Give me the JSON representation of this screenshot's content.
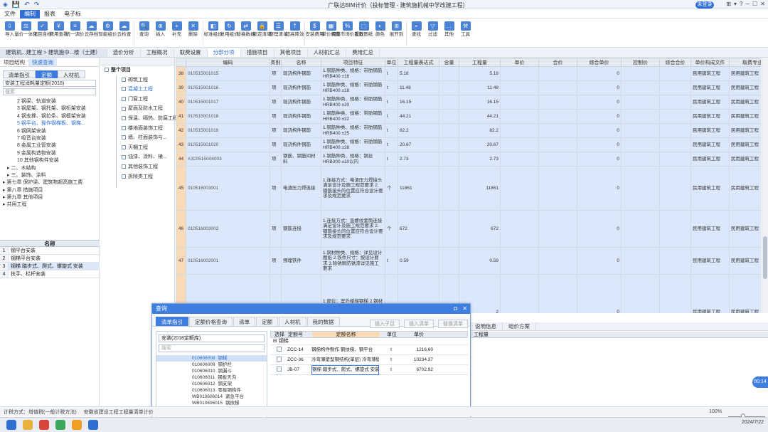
{
  "window": {
    "title": "广联达BIM计价（投标管理 - 建筑施机械中学改建工程）",
    "login_badge": "未登录",
    "controls": [
      "⊞",
      "▾",
      "◻",
      "?",
      "─",
      "☐",
      "✕"
    ]
  },
  "menu": [
    "文件",
    "编制",
    "报表",
    "电子标"
  ],
  "toolbar": [
    "导入",
    "量价一体化",
    "项目自检",
    "费用查看",
    "统一调价",
    "云存档",
    "智能组价",
    "云检查",
    "查询",
    "插入",
    "补充",
    "删除",
    "标准组价",
    "复用组价",
    "替换数据",
    "锁定清单",
    "整理清单",
    "超高降效",
    "安装费用",
    "单价构成",
    "调整市场价系数",
    "提取图纸",
    "颜色",
    "展开到",
    "查找",
    "过滤",
    "其他",
    "工具"
  ],
  "doc_tabs": [
    "建筑机...建工程 > 建筑施中...楼（土建）",
    "造价分析",
    "工程概况",
    "取费设置",
    "分部分项",
    "措施项目",
    "其他项目",
    "人材机汇总",
    "费用汇总"
  ],
  "left_tabs": [
    "项目结构",
    "快速查询"
  ],
  "left_seg": [
    "清单指引",
    "定额",
    "人材机"
  ],
  "left_select": "安装工程消耗量定额(2018)",
  "left_search": "搜索",
  "left_tree": [
    "2  钢梁、轨道安装",
    "3  钢屋架、钢托架、钢桁架安装",
    "4  钢支撑、钢拉条、钢檩架安装",
    "5  钢平台、操作钢梯板、钢梯...",
    "6  钢网架安装",
    "7  吸音台安装",
    "8  金属工业管安装",
    "9  金属构造物安装",
    "10  其他钢构件安装",
    "▸ 二、木结构",
    "▸ 三、装饰、涂料",
    "▸ 第七章 保护梁、建筑物超高施工费",
    "▸ 第八章 措施项目",
    "▸ 第九章 其他项目",
    "▸ 共用工程"
  ],
  "left_mini_table": {
    "header": "名称",
    "rows": [
      "钢平台安装",
      "钢梯平台安装",
      "钢梯 踏步式、爬式、螺旋式 安装",
      "扶手、栏杆安装"
    ]
  },
  "project_tree": {
    "root": "整个项目",
    "items": [
      "砌筑工程",
      "混凝土工程",
      "门窗工程",
      "屋面及防水工程",
      "保温、隔热、防腐工程",
      "楼地面装饰工程",
      "墙、柱面装饰与...",
      "天棚工程",
      "油漆、涂料、裱...",
      "其他装饰工程",
      "拆除类工程"
    ]
  },
  "grid": {
    "headers": [
      "",
      "编码",
      "类别",
      "名称",
      "项目特征",
      "单位",
      "工程量表达式",
      "含量",
      "工程量",
      "单价",
      "合价",
      "综合单价",
      "控制价",
      "综合合价",
      "单价构成文件",
      "取费专业"
    ],
    "rows": [
      {
        "idx": "38",
        "code": "010515001015",
        "type": "项",
        "name": "现浇构件钢筋",
        "spec": "1.钢筋种类、规格：带肋钢筋 HRB400 ±16",
        "unit": "t",
        "expr": "5.18",
        "qty": "5.18",
        "price": "0",
        "file": "民用建筑工程",
        "prof": "民用建筑工程"
      },
      {
        "idx": "39",
        "code": "010515001016",
        "type": "项",
        "name": "现浇构件钢筋",
        "spec": "1.钢筋种类、规格：带肋钢筋 HRB400 ±18",
        "unit": "t",
        "expr": "11.48",
        "qty": "11.48",
        "price": "0",
        "file": "民用建筑工程",
        "prof": "民用建筑工程"
      },
      {
        "idx": "40",
        "code": "010515001017",
        "type": "项",
        "name": "现浇构件钢筋",
        "spec": "1.钢筋种类、规格：带肋钢筋 HRB400 ±20",
        "unit": "t",
        "expr": "16.15",
        "qty": "16.15",
        "price": "0",
        "file": "民用建筑工程",
        "prof": "民用建筑工程"
      },
      {
        "idx": "41",
        "code": "010515001018",
        "type": "项",
        "name": "现浇构件钢筋",
        "spec": "1.钢筋种类、规格：带肋钢筋 HRB400 ±22",
        "unit": "t",
        "expr": "44.21",
        "qty": "44.21",
        "price": "0",
        "file": "民用建筑工程",
        "prof": "民用建筑工程"
      },
      {
        "idx": "42",
        "code": "010515001019",
        "type": "项",
        "name": "现浇构件钢筋",
        "spec": "1.钢筋种类、规格：带肋钢筋 HRB400 ±25",
        "unit": "t",
        "expr": "82.2",
        "qty": "82.2",
        "price": "0",
        "file": "民用建筑工程",
        "prof": "民用建筑工程"
      },
      {
        "idx": "43",
        "code": "010515001020",
        "type": "项",
        "name": "现浇构件钢筋",
        "spec": "1.钢筋种类、规格：带肋钢筋 HRB400 ±28",
        "unit": "t",
        "expr": "20.67",
        "qty": "20.67",
        "price": "0",
        "file": "民用建筑工程",
        "prof": "民用建筑工程"
      },
      {
        "idx": "44",
        "code": "#JC0515004003",
        "type": "项",
        "name": "钢筋、钢筋间材料",
        "spec": "1.钢筋种类、规格：钢丝 HRB300 ±10以内",
        "unit": "t",
        "expr": "2.73",
        "qty": "2.73",
        "price": "0",
        "file": "民用建筑工程",
        "prof": "民用建筑工程"
      },
      {
        "idx": "45",
        "code": "010516003001",
        "type": "项",
        "name": "电渣压力焊连接",
        "spec": "1.连接方式：电渣压力焊接头满足设计及施工规范要求 2.钢筋接头的位置应符合设计要求及规范要求",
        "unit": "个",
        "expr": "11861",
        "qty": "11861",
        "price": "0",
        "file": "民用建筑工程",
        "prof": "民用建筑工程"
      },
      {
        "idx": "46",
        "code": "010516003002",
        "type": "项",
        "name": "钢筋连接",
        "spec": "1.连接方式：直螺纹套筒连接满足设计及施工规范要求 2.钢筋接头的位置应符合设计要求及规范要求",
        "unit": "个",
        "expr": "672",
        "qty": "672",
        "price": "0",
        "file": "民用建筑工程",
        "prof": "民用建筑工程"
      },
      {
        "idx": "47",
        "code": "010516002001",
        "type": "项",
        "name": "预埋铁件",
        "spec": "1.钢材种类、规格：详见设计图纸 2.铁件尺寸：按设计要求 3.除锈刷防锈漆详见施工要求",
        "unit": "t",
        "expr": "0.59",
        "qty": "0.59",
        "price": "0",
        "file": "民用建筑工程",
        "prof": "民用建筑工程"
      },
      {
        "idx": "48",
        "code": "010606008001",
        "type": "项",
        "name": "钢梯",
        "spec": "1.部位：室外楼梯钢梯 2.钢材品种、规格：满足设计、规范要求 3.除锈刷防锈漆详见施工图纸 4.其他：详见设计图纸、国标及地方规范",
        "unit": "t",
        "expr": "2",
        "qty": "2",
        "price": "0",
        "file": "民用建筑工程",
        "prof": "民用建筑工程"
      }
    ]
  },
  "bottom_tabs": [
    "说明信息",
    "组价方案"
  ],
  "bottom_header": "工程量",
  "dialog": {
    "title": "查询",
    "tabs": [
      "清单指引",
      "定额价格查询",
      "清单",
      "定额",
      "人材机",
      "我的数据"
    ],
    "select": "安装(2018定额库)",
    "search": "搜索",
    "list": [
      {
        "code": "010606008",
        "name": "钢梯",
        "sel": true
      },
      {
        "code": "010606009",
        "name": "钢护栏"
      },
      {
        "code": "010606010",
        "name": "钢漏斗"
      },
      {
        "code": "010606011",
        "name": "钢板天沟"
      },
      {
        "code": "010606012",
        "name": "钢支架"
      },
      {
        "code": "010606013",
        "name": "零星钢构件"
      },
      {
        "code": "WB010606014",
        "name": "紧急平台"
      },
      {
        "code": "WB010606015",
        "name": "钢扶梯"
      }
    ],
    "buttons": [
      "插入子目",
      "插入清单",
      "替换清单"
    ],
    "table_headers": [
      "选择",
      "定额号",
      "定额名称",
      "单位",
      "单价"
    ],
    "group": "钢梯",
    "rows": [
      {
        "code": "ZCC-14",
        "name": "钢梯构件制作 钢扶梯、钢平台",
        "unit": "t",
        "price": "1216.60"
      },
      {
        "code": "ZCC-36",
        "name": "冷弯薄壁型钢结构(单层) 冷弯薄壁钢桁架",
        "unit": "t",
        "price": "10234.37"
      },
      {
        "code": "JB-07",
        "name": "钢梯 踏步式、爬式、螺旋式 安装",
        "unit": "t",
        "price": "6702.92"
      }
    ]
  },
  "status": {
    "calc_mode": "计税方式：增值税(一般计税方法)",
    "standard": "安徽省建设工程工程量清单计价",
    "zoom": "100%"
  },
  "float_badge": "00:14",
  "clock": "2024/7/22"
}
